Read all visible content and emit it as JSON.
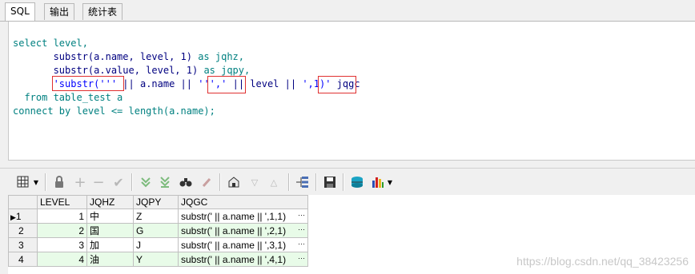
{
  "tabs": [
    {
      "label": "SQL",
      "active": true
    },
    {
      "label": "输出",
      "active": false
    },
    {
      "label": "统计表",
      "active": false
    }
  ],
  "sql": {
    "line1": "select level,",
    "line2_fn": "substr(a.name, level, 1)",
    "line2_as": "as jqhz,",
    "line3_fn": "substr(a.value, level, 1)",
    "line3_as": "as jqpy,",
    "line4_str1": "'substr('''",
    "line4_mid1": "|| a.name ||",
    "line4_str2": "''','",
    "line4_mid2": "|| level ||",
    "line4_str3": "',1)'",
    "line4_alias": "jqgc",
    "line5": "from table_test a",
    "line6": "connect by level <= length(a.name);"
  },
  "toolbar_icons": [
    "grid-menu-icon",
    "lock-icon",
    "add-record-icon",
    "delete-record-icon",
    "post-changes-icon",
    "fetch-next-icon",
    "fetch-last-icon",
    "find-icon",
    "clear-icon",
    "query-by-example-icon",
    "filter-icon",
    "sort-icon",
    "link-icon",
    "save-icon",
    "export-icon",
    "chart-icon"
  ],
  "grid": {
    "columns": [
      "LEVEL",
      "JQHZ",
      "JQPY",
      "JQGC"
    ],
    "rows": [
      {
        "num": "1",
        "level": "1",
        "jqhz": "中",
        "jqpy": "Z",
        "jqgc": "substr(' || a.name || ',1,1)"
      },
      {
        "num": "2",
        "level": "2",
        "jqhz": "国",
        "jqpy": "G",
        "jqgc": "substr(' || a.name || ',2,1)"
      },
      {
        "num": "3",
        "level": "3",
        "jqhz": "加",
        "jqpy": "J",
        "jqgc": "substr(' || a.name || ',3,1)"
      },
      {
        "num": "4",
        "level": "4",
        "jqhz": "油",
        "jqpy": "Y",
        "jqgc": "substr(' || a.name || ',4,1)"
      }
    ],
    "ellipsis": "···"
  },
  "watermark": "https://blog.csdn.net/qq_38423256",
  "colors": {
    "keyword": "#008080",
    "string": "#0000ff",
    "highlight_box": "#e03030",
    "even_row": "#e8fbe8"
  }
}
